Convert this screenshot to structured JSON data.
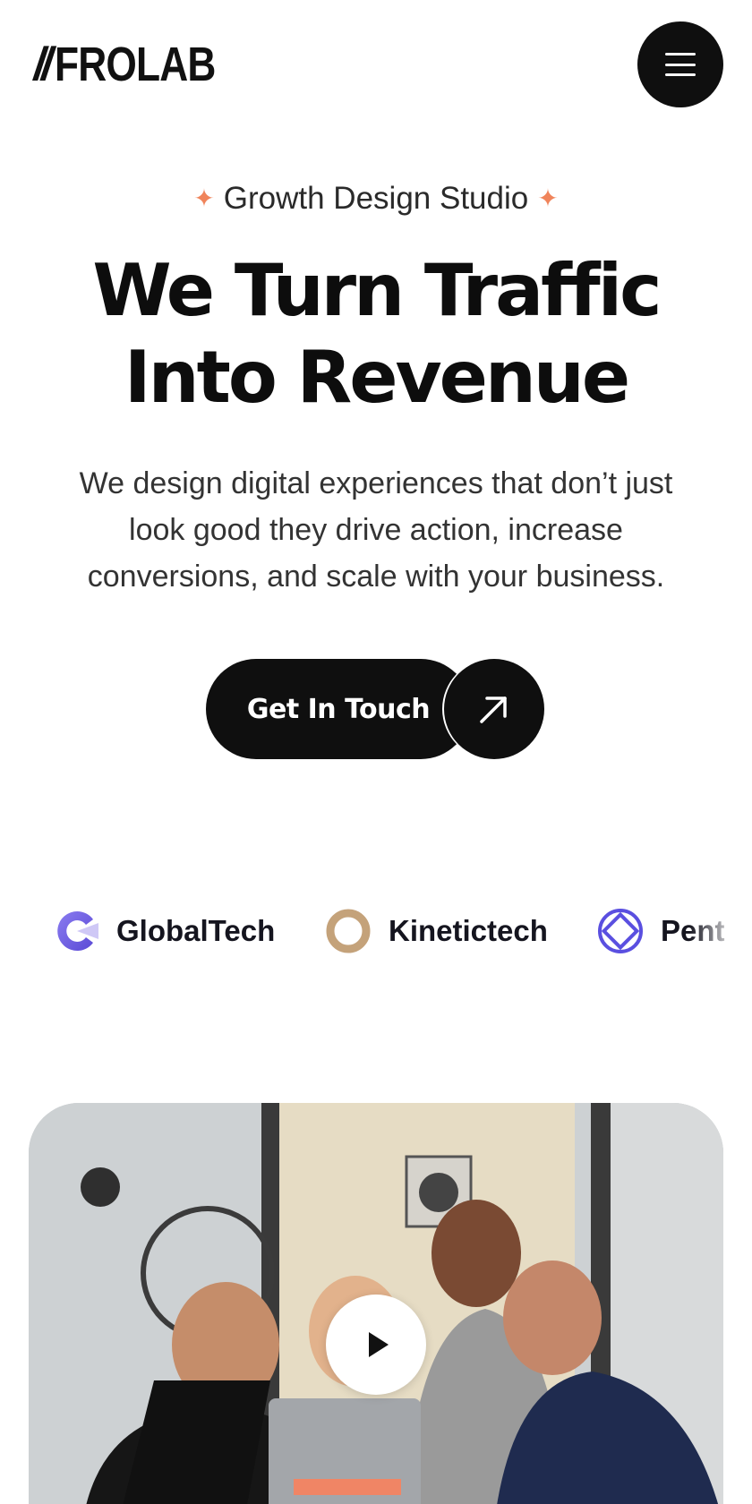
{
  "header": {
    "logo_mark": "//",
    "logo_text": "FROLAB",
    "menu_icon": "hamburger-menu-icon"
  },
  "hero": {
    "eyebrow": "Growth Design Studio",
    "eyebrow_icon": "sparkle-star-icon",
    "title_line1": "We Turn Traffic",
    "title_line2": "Into Revenue",
    "subtitle": "We design digital experiences that don’t just look good they drive action, increase conversions, and scale with your business.",
    "cta_label": "Get In Touch",
    "cta_icon": "arrow-up-right-icon"
  },
  "clients": [
    {
      "name": "GlobalTech",
      "icon": "globaltech-logo-icon"
    },
    {
      "name": "Kinetictech",
      "icon": "kinetictech-ring-icon"
    },
    {
      "name": "Pent",
      "icon": "pent-diamond-ring-icon"
    }
  ],
  "video": {
    "play_icon": "play-icon"
  },
  "colors": {
    "text_primary": "#0d0d0d",
    "text_body": "#333333",
    "button_bg": "#0f0f0f",
    "accent_star": "#f0845b",
    "globaltech_purple": "#7b6ce0",
    "kinetictech_tan": "#c4a27a",
    "pent_blue": "#5a4fe0"
  }
}
